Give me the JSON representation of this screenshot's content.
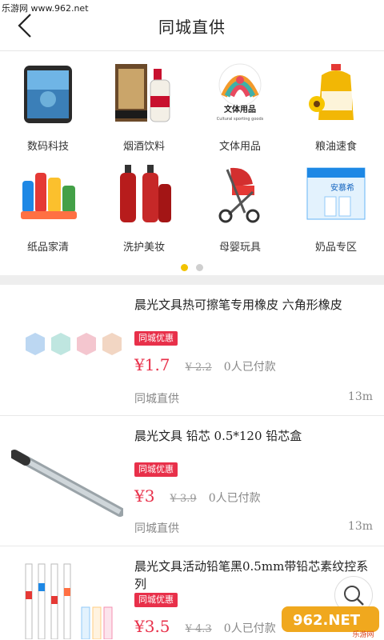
{
  "watermark": "乐游网 www.962.net",
  "header": {
    "title": "同城直供"
  },
  "categories": [
    {
      "label": "数码科技",
      "icon": "phone-icon"
    },
    {
      "label": "烟酒饮料",
      "icon": "liquor-icon"
    },
    {
      "label": "文体用品",
      "icon": "stationery-logo-icon",
      "logo_text": "文体用品",
      "logo_sub": "Cultural sporting goods"
    },
    {
      "label": "粮油速食",
      "icon": "oil-bottle-icon"
    },
    {
      "label": "纸品家清",
      "icon": "cleaning-icon"
    },
    {
      "label": "洗护美妆",
      "icon": "shampoo-icon"
    },
    {
      "label": "母婴玩具",
      "icon": "stroller-icon"
    },
    {
      "label": "奶品专区",
      "icon": "milk-box-icon",
      "box_text": "安慕希"
    }
  ],
  "carousel": {
    "pages": 2,
    "active": 0
  },
  "products": [
    {
      "title": "晨光文具热可擦笔专用橡皮 六角形橡皮",
      "badge": "同城优惠",
      "price": "¥1.7",
      "orig_price": "¥ 2.2",
      "paid": "0人已付款",
      "source": "同城直供",
      "distance": "13m"
    },
    {
      "title": "晨光文具 铅芯 0.5*120 铅芯盒",
      "badge": "同城优惠",
      "price": "¥3",
      "orig_price": "¥ 3.9",
      "paid": "0人已付款",
      "source": "同城直供",
      "distance": "13m"
    },
    {
      "title": "晨光文具活动铅笔黑0.5mm带铅芯素纹控系列",
      "badge": "同城优惠",
      "price": "¥3.5",
      "orig_price": "¥ 4.3",
      "paid": "0人已付款"
    }
  ],
  "logo_watermark": {
    "main": "962.NET",
    "sub": "乐游网"
  },
  "colors": {
    "accent": "#e8304a",
    "dot_active": "#f2c300"
  }
}
